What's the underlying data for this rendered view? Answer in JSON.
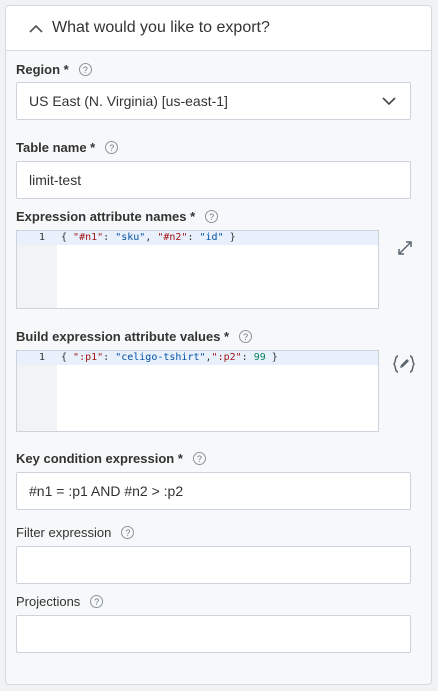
{
  "panel": {
    "title": "What would you like to export?"
  },
  "help_glyph": "?",
  "region": {
    "label": "Region *",
    "value": "US East (N. Virginia) [us-east-1]"
  },
  "table_name": {
    "label": "Table name *",
    "value": "limit-test"
  },
  "expr_names": {
    "label": "Expression attribute names *",
    "line_number": "1",
    "code_parts": [
      "{ ",
      "\"#n1\"",
      ": ",
      "\"sku\"",
      ", ",
      "\"#n2\"",
      ": ",
      "\"id\"",
      " }"
    ]
  },
  "build_values": {
    "label": "Build expression attribute values *",
    "line_number": "1",
    "code_parts": [
      "{ ",
      "\":p1\"",
      ": ",
      "\"celigo-tshirt\"",
      ",",
      "\":p2\"",
      ": ",
      "99",
      " }"
    ]
  },
  "key_condition": {
    "label": "Key condition expression *",
    "value": "#n1 = :p1 AND #n2 > :p2"
  },
  "filter_expression": {
    "label": "Filter expression",
    "value": ""
  },
  "projections": {
    "label": "Projections",
    "value": ""
  },
  "colors": {
    "code_key": "#a31515",
    "code_string": "#0451a5",
    "code_number": "#098658",
    "border": "#ccd3da"
  },
  "icons": {
    "collapse": "chevron-up-icon",
    "select": "chevron-down-icon",
    "expand": "expand-icon",
    "edit": "edit-json-icon"
  }
}
